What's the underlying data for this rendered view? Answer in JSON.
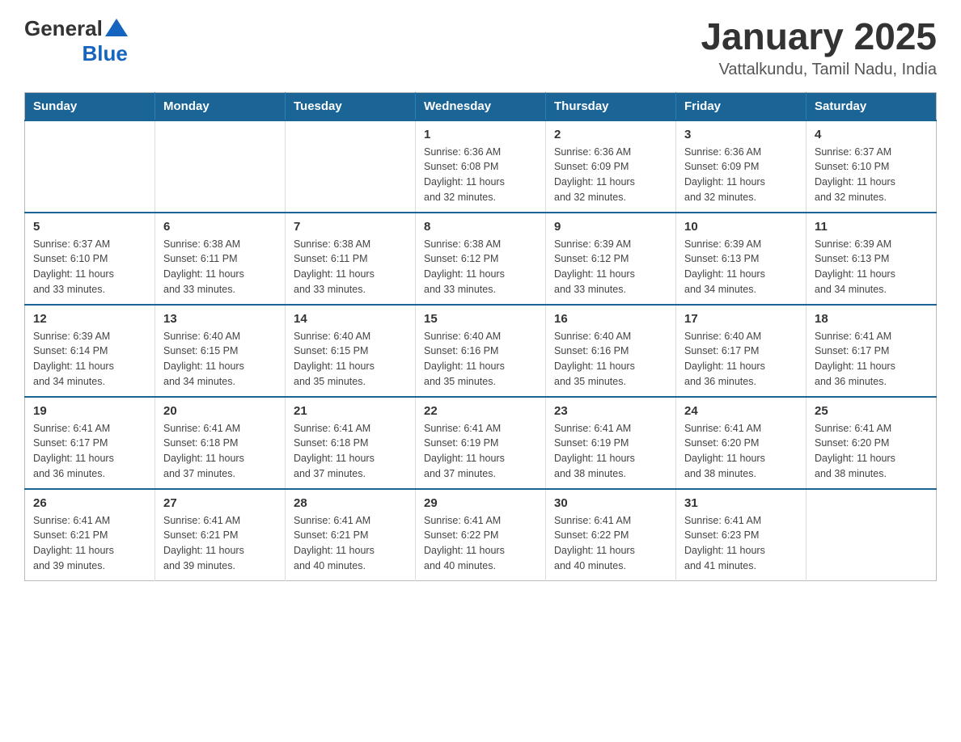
{
  "header": {
    "logo_general": "General",
    "logo_blue": "Blue",
    "title": "January 2025",
    "subtitle": "Vattalkundu, Tamil Nadu, India"
  },
  "days_of_week": [
    "Sunday",
    "Monday",
    "Tuesday",
    "Wednesday",
    "Thursday",
    "Friday",
    "Saturday"
  ],
  "weeks": [
    [
      {
        "day": "",
        "info": ""
      },
      {
        "day": "",
        "info": ""
      },
      {
        "day": "",
        "info": ""
      },
      {
        "day": "1",
        "info": "Sunrise: 6:36 AM\nSunset: 6:08 PM\nDaylight: 11 hours\nand 32 minutes."
      },
      {
        "day": "2",
        "info": "Sunrise: 6:36 AM\nSunset: 6:09 PM\nDaylight: 11 hours\nand 32 minutes."
      },
      {
        "day": "3",
        "info": "Sunrise: 6:36 AM\nSunset: 6:09 PM\nDaylight: 11 hours\nand 32 minutes."
      },
      {
        "day": "4",
        "info": "Sunrise: 6:37 AM\nSunset: 6:10 PM\nDaylight: 11 hours\nand 32 minutes."
      }
    ],
    [
      {
        "day": "5",
        "info": "Sunrise: 6:37 AM\nSunset: 6:10 PM\nDaylight: 11 hours\nand 33 minutes."
      },
      {
        "day": "6",
        "info": "Sunrise: 6:38 AM\nSunset: 6:11 PM\nDaylight: 11 hours\nand 33 minutes."
      },
      {
        "day": "7",
        "info": "Sunrise: 6:38 AM\nSunset: 6:11 PM\nDaylight: 11 hours\nand 33 minutes."
      },
      {
        "day": "8",
        "info": "Sunrise: 6:38 AM\nSunset: 6:12 PM\nDaylight: 11 hours\nand 33 minutes."
      },
      {
        "day": "9",
        "info": "Sunrise: 6:39 AM\nSunset: 6:12 PM\nDaylight: 11 hours\nand 33 minutes."
      },
      {
        "day": "10",
        "info": "Sunrise: 6:39 AM\nSunset: 6:13 PM\nDaylight: 11 hours\nand 34 minutes."
      },
      {
        "day": "11",
        "info": "Sunrise: 6:39 AM\nSunset: 6:13 PM\nDaylight: 11 hours\nand 34 minutes."
      }
    ],
    [
      {
        "day": "12",
        "info": "Sunrise: 6:39 AM\nSunset: 6:14 PM\nDaylight: 11 hours\nand 34 minutes."
      },
      {
        "day": "13",
        "info": "Sunrise: 6:40 AM\nSunset: 6:15 PM\nDaylight: 11 hours\nand 34 minutes."
      },
      {
        "day": "14",
        "info": "Sunrise: 6:40 AM\nSunset: 6:15 PM\nDaylight: 11 hours\nand 35 minutes."
      },
      {
        "day": "15",
        "info": "Sunrise: 6:40 AM\nSunset: 6:16 PM\nDaylight: 11 hours\nand 35 minutes."
      },
      {
        "day": "16",
        "info": "Sunrise: 6:40 AM\nSunset: 6:16 PM\nDaylight: 11 hours\nand 35 minutes."
      },
      {
        "day": "17",
        "info": "Sunrise: 6:40 AM\nSunset: 6:17 PM\nDaylight: 11 hours\nand 36 minutes."
      },
      {
        "day": "18",
        "info": "Sunrise: 6:41 AM\nSunset: 6:17 PM\nDaylight: 11 hours\nand 36 minutes."
      }
    ],
    [
      {
        "day": "19",
        "info": "Sunrise: 6:41 AM\nSunset: 6:17 PM\nDaylight: 11 hours\nand 36 minutes."
      },
      {
        "day": "20",
        "info": "Sunrise: 6:41 AM\nSunset: 6:18 PM\nDaylight: 11 hours\nand 37 minutes."
      },
      {
        "day": "21",
        "info": "Sunrise: 6:41 AM\nSunset: 6:18 PM\nDaylight: 11 hours\nand 37 minutes."
      },
      {
        "day": "22",
        "info": "Sunrise: 6:41 AM\nSunset: 6:19 PM\nDaylight: 11 hours\nand 37 minutes."
      },
      {
        "day": "23",
        "info": "Sunrise: 6:41 AM\nSunset: 6:19 PM\nDaylight: 11 hours\nand 38 minutes."
      },
      {
        "day": "24",
        "info": "Sunrise: 6:41 AM\nSunset: 6:20 PM\nDaylight: 11 hours\nand 38 minutes."
      },
      {
        "day": "25",
        "info": "Sunrise: 6:41 AM\nSunset: 6:20 PM\nDaylight: 11 hours\nand 38 minutes."
      }
    ],
    [
      {
        "day": "26",
        "info": "Sunrise: 6:41 AM\nSunset: 6:21 PM\nDaylight: 11 hours\nand 39 minutes."
      },
      {
        "day": "27",
        "info": "Sunrise: 6:41 AM\nSunset: 6:21 PM\nDaylight: 11 hours\nand 39 minutes."
      },
      {
        "day": "28",
        "info": "Sunrise: 6:41 AM\nSunset: 6:21 PM\nDaylight: 11 hours\nand 40 minutes."
      },
      {
        "day": "29",
        "info": "Sunrise: 6:41 AM\nSunset: 6:22 PM\nDaylight: 11 hours\nand 40 minutes."
      },
      {
        "day": "30",
        "info": "Sunrise: 6:41 AM\nSunset: 6:22 PM\nDaylight: 11 hours\nand 40 minutes."
      },
      {
        "day": "31",
        "info": "Sunrise: 6:41 AM\nSunset: 6:23 PM\nDaylight: 11 hours\nand 41 minutes."
      },
      {
        "day": "",
        "info": ""
      }
    ]
  ]
}
